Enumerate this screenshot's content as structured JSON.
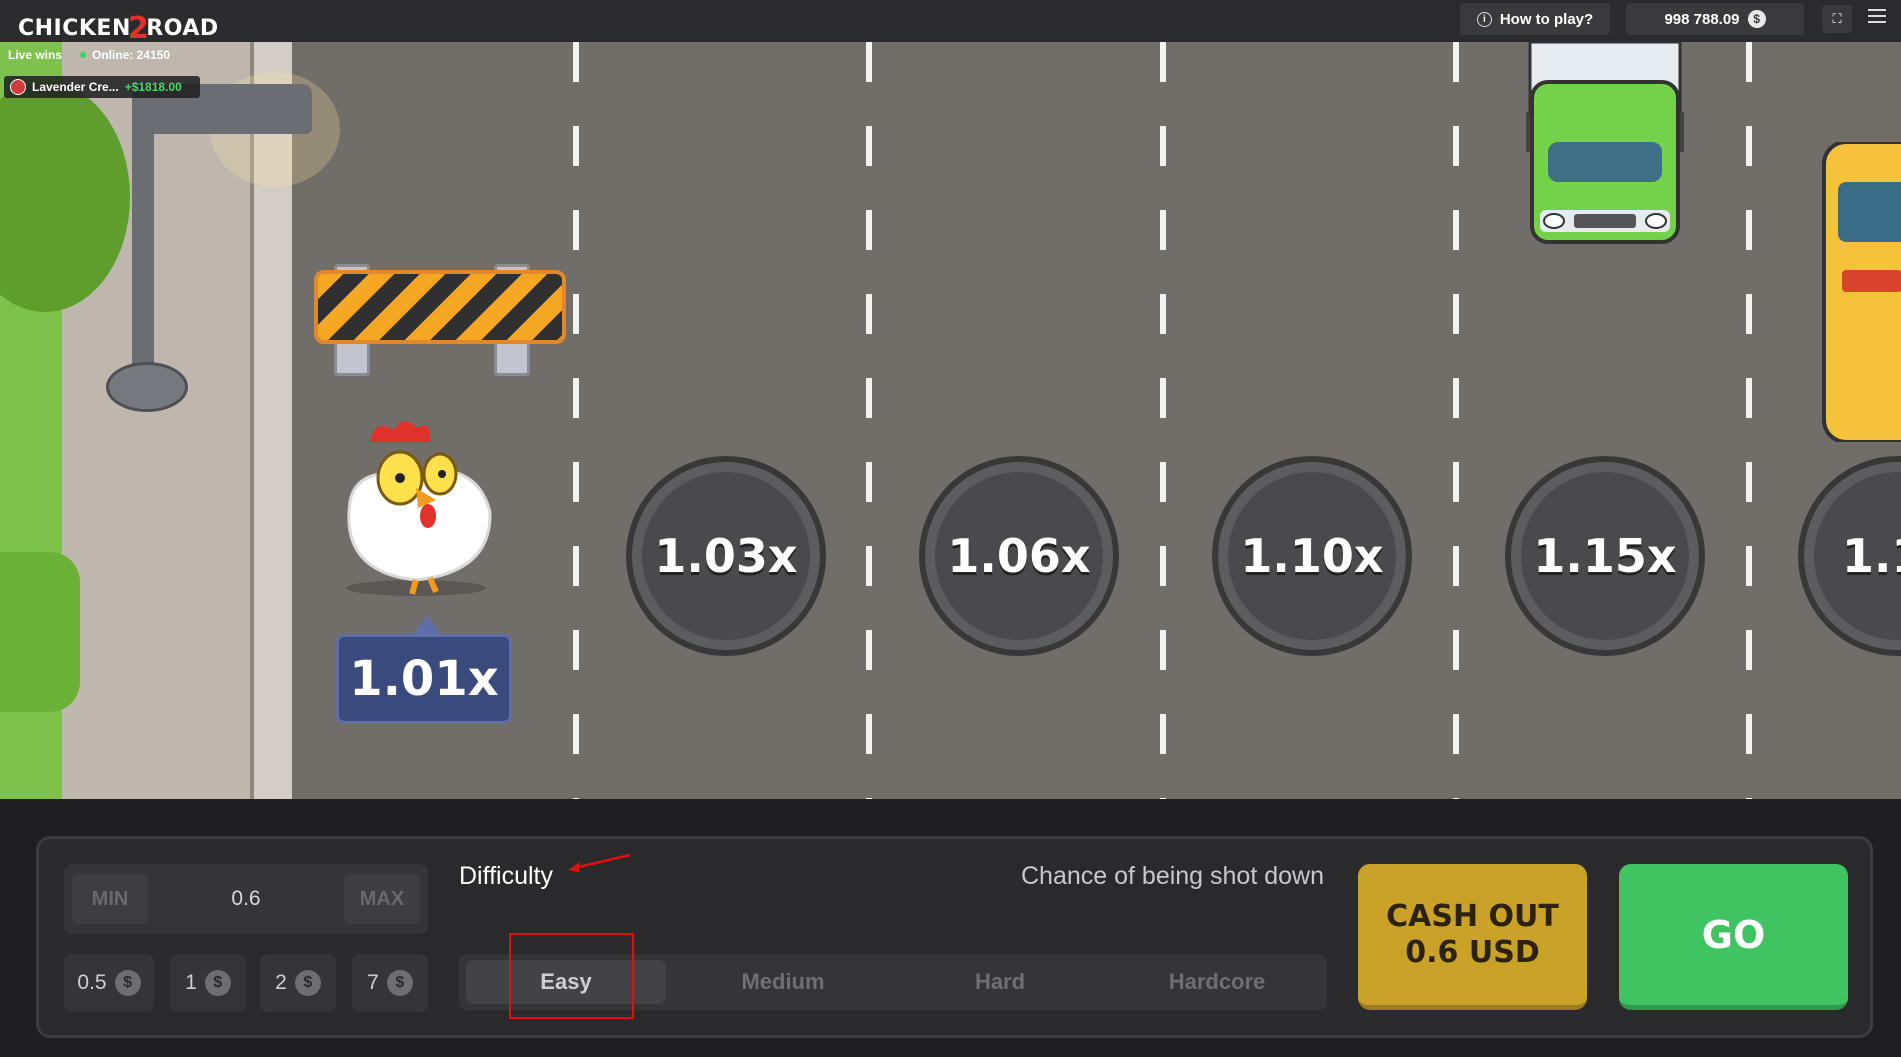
{
  "header": {
    "logo_text_a": "CHICKEN",
    "logo_text_b": "2",
    "logo_text_c": "ROAD",
    "how_to_play": "How to play?",
    "balance": "998 788.09",
    "currency_symbol": "$"
  },
  "live": {
    "label": "Live wins",
    "online": "Online: 24150",
    "recent_win": {
      "player": "Lavender Cre...",
      "amount": "+$1818.00"
    }
  },
  "game": {
    "current_multiplier": "1.01x",
    "lanes": [
      "1.03x",
      "1.06x",
      "1.10x",
      "1.15x",
      "1.1"
    ]
  },
  "bet": {
    "min_label": "MIN",
    "max_label": "MAX",
    "value": "0.6",
    "quick_amounts": [
      "0.5",
      "1",
      "2",
      "7"
    ]
  },
  "difficulty": {
    "label": "Difficulty",
    "chance_label": "Chance of being shot down",
    "options": [
      "Easy",
      "Medium",
      "Hard",
      "Hardcore"
    ],
    "selected": "Easy"
  },
  "actions": {
    "cashout_line1": "CASH OUT",
    "cashout_line2": "0.6 USD",
    "go": "GO"
  },
  "colors": {
    "cashout": "#c9a227",
    "go": "#40c462",
    "annotation": "#e01010"
  }
}
